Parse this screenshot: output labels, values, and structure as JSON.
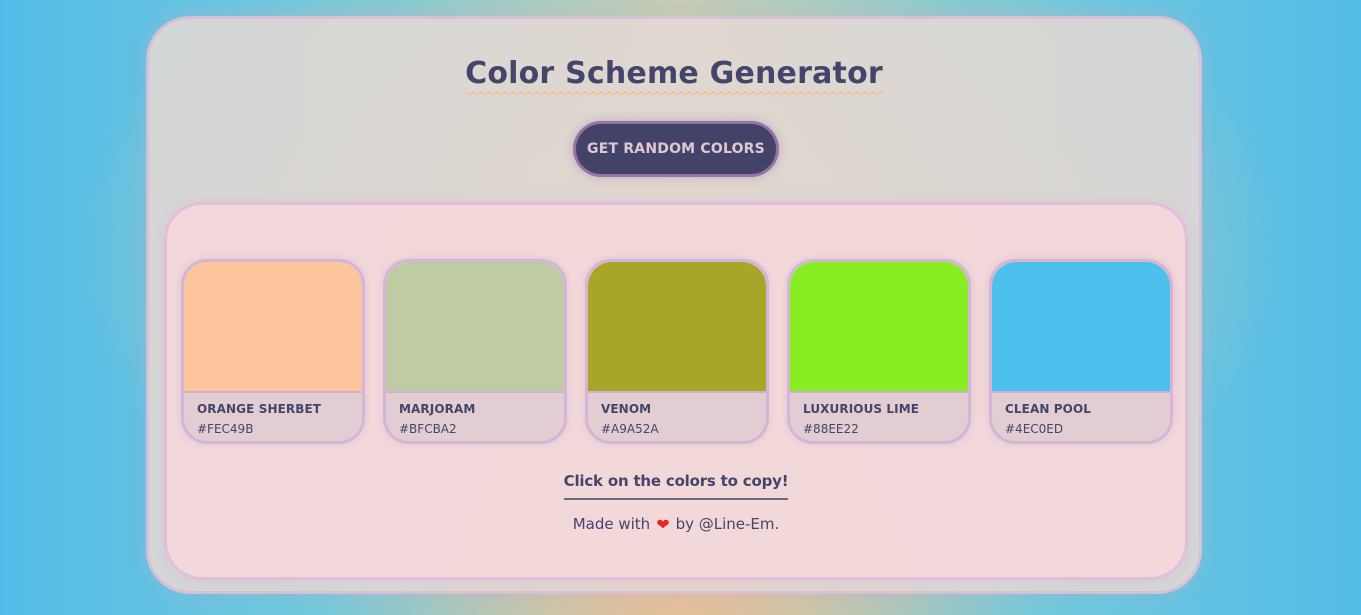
{
  "app": {
    "title": "Color Scheme Generator",
    "button_label": "GET RANDOM COLORS"
  },
  "colors": [
    {
      "name": "ORANGE SHERBET",
      "hex": "#FEC49B",
      "swatch": "#FEC49B"
    },
    {
      "name": "MARJORAM",
      "hex": "#BFCBA2",
      "swatch": "#BFCBA2"
    },
    {
      "name": "VENOM",
      "hex": "#A9A52A",
      "swatch": "#A9A52A"
    },
    {
      "name": "LUXURIOUS LIME",
      "hex": "#88EE22",
      "swatch": "#88EE22"
    },
    {
      "name": "CLEAN POOL",
      "hex": "#4EC0ED",
      "swatch": "#4EC0ED"
    }
  ],
  "hint": "Click on the colors to copy!",
  "footer": {
    "prefix": "Made with",
    "heart_icon": "heart-icon",
    "heart_glyph": "❤",
    "suffix": "by @Line-Em."
  },
  "theme": {
    "accent": "#43436A",
    "heart_color": "#E8262B"
  }
}
